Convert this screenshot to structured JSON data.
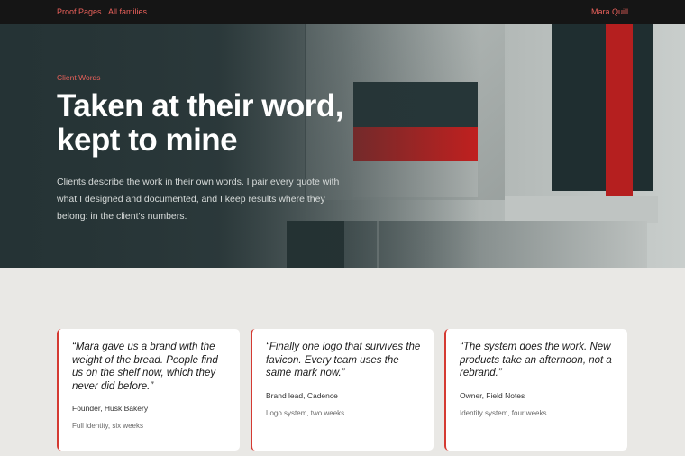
{
  "topbar": {
    "breadcrumb": "Proof Pages · All families",
    "user": "Mara Quill"
  },
  "hero": {
    "eyebrow": "Client Words",
    "title": "Taken at their word, kept to mine",
    "lede": "Clients describe the work in their own words. I pair every quote with what I designed and documented, and I keep results where they belong: in the client's numbers."
  },
  "testimonials": [
    {
      "quote": "“Mara gave us a brand with the weight of the bread. People find us on the shelf now, which they never did before.”",
      "attribution": "Founder, Husk Bakery",
      "scope": "Full identity, six weeks"
    },
    {
      "quote": "“Finally one logo that survives the favicon. Every team uses the same mark now.”",
      "attribution": "Brand lead, Cadence",
      "scope": "Logo system, two weeks"
    },
    {
      "quote": "“The system does the work. New products take an afternoon, not a rebrand.”",
      "attribution": "Owner, Field Notes",
      "scope": "Identity system, four weeks"
    }
  ],
  "colors": {
    "accent": "#e8605a",
    "card_border": "#d43a32",
    "hero_bg": "#263436",
    "topbar_bg": "#151515",
    "page_bg": "#e9e8e5"
  }
}
